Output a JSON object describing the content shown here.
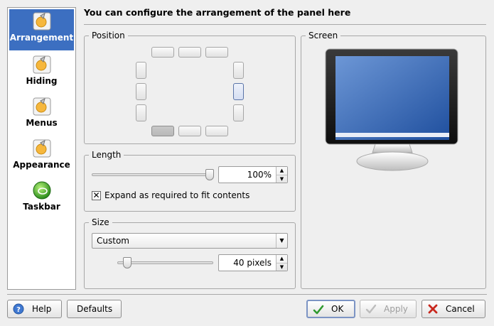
{
  "sidebar": {
    "items": [
      {
        "label": "Arrangement",
        "icon": "arrangement-icon"
      },
      {
        "label": "Hiding",
        "icon": "hiding-icon"
      },
      {
        "label": "Menus",
        "icon": "menus-icon"
      },
      {
        "label": "Appearance",
        "icon": "appearance-icon"
      },
      {
        "label": "Taskbar",
        "icon": "taskbar-icon"
      }
    ]
  },
  "heading": "You can configure the arrangement of the panel here",
  "position": {
    "title": "Position"
  },
  "screen": {
    "title": "Screen"
  },
  "length": {
    "title": "Length",
    "value": "100%",
    "expand_label": "Expand as required to fit contents",
    "expand_checked": true
  },
  "size": {
    "title": "Size",
    "combo_value": "Custom",
    "pixels_value": "40 pixels"
  },
  "buttons": {
    "help": "Help",
    "defaults": "Defaults",
    "ok": "OK",
    "apply": "Apply",
    "cancel": "Cancel"
  },
  "colors": {
    "accent": "#3c6fc1",
    "ok_check": "#2f9a2f",
    "cancel_x": "#c8281e"
  }
}
